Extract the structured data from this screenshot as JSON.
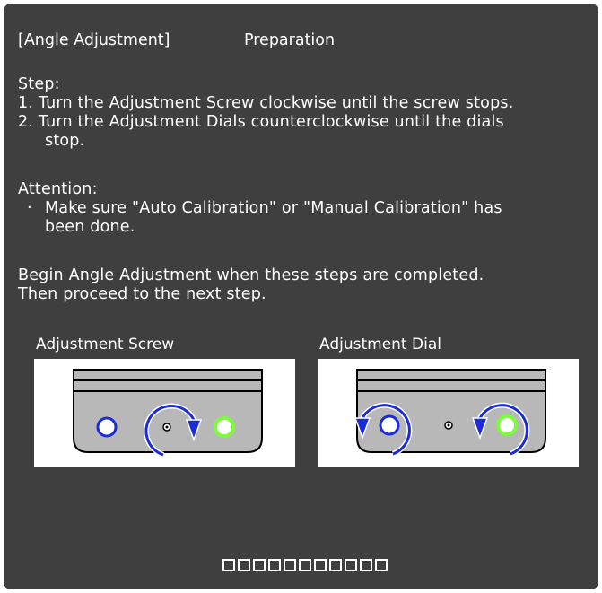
{
  "header": {
    "title": "[Angle Adjustment]",
    "section": "Preparation"
  },
  "steps": {
    "heading": "Step:",
    "item1": "1. Turn the Adjustment Screw clockwise until the screw stops.",
    "item2_line1": "2. Turn the Adjustment Dials counterclockwise until the dials",
    "item2_line2": "stop."
  },
  "attention": {
    "heading": "Attention:",
    "bullet": "·",
    "line1": "Make sure \"Auto Calibration\" or \"Manual Calibration\" has",
    "line2": "been done."
  },
  "footer_text": {
    "line1": "Begin Angle Adjustment when these steps are completed.",
    "line2": "Then proceed to the next step."
  },
  "diagrams": {
    "screw_label": "Adjustment Screw",
    "dial_label": "Adjustment Dial"
  },
  "progress": {
    "total": 11
  },
  "colors": {
    "background": "#3f3f3f",
    "text": "#ffffff",
    "arrow_blue": "#1a2bd8",
    "dial_green": "#7cfc3a"
  }
}
